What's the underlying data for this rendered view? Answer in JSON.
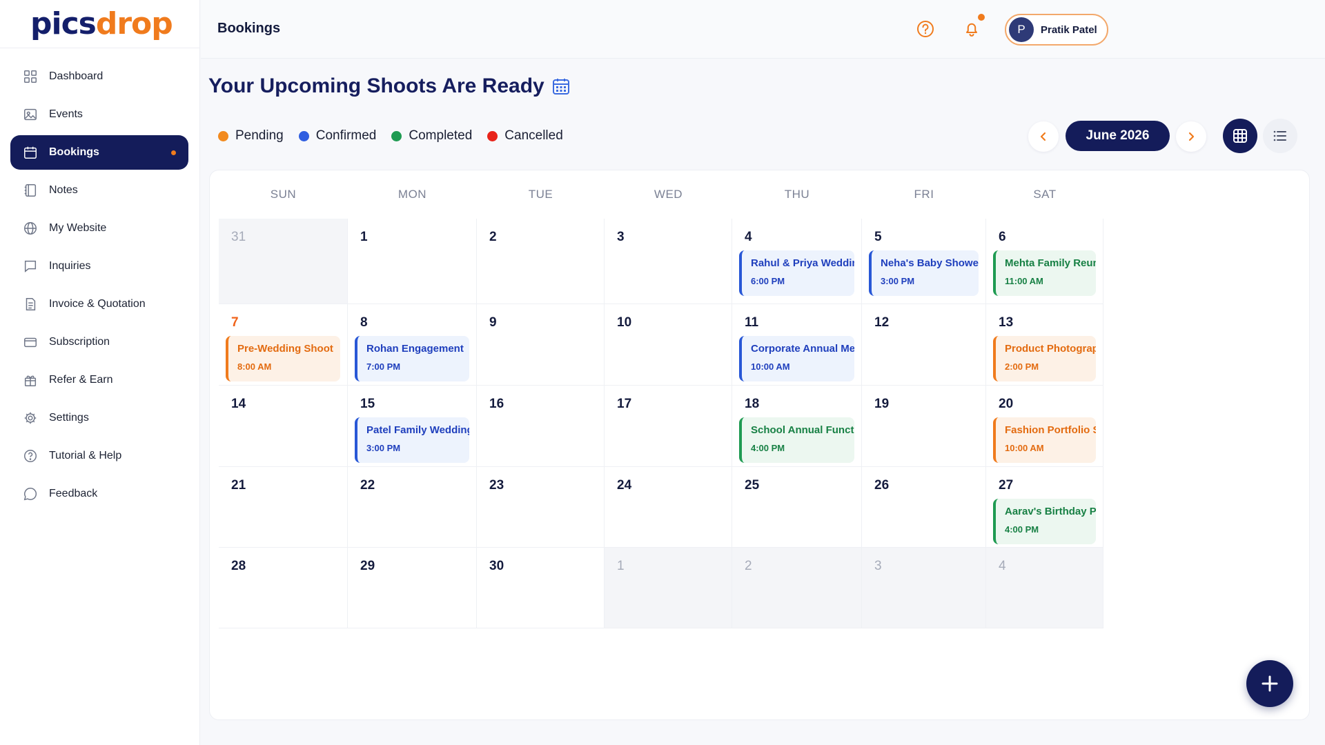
{
  "app": {
    "logo_part1": "pics",
    "logo_part2": "drop"
  },
  "sidebar": {
    "items": [
      {
        "label": "Dashboard",
        "icon": "dashboard-icon"
      },
      {
        "label": "Events",
        "icon": "image-icon"
      },
      {
        "label": "Bookings",
        "icon": "calendar-icon",
        "active": true
      },
      {
        "label": "Notes",
        "icon": "notebook-icon"
      },
      {
        "label": "My Website",
        "icon": "globe-icon"
      },
      {
        "label": "Inquiries",
        "icon": "chat-icon"
      },
      {
        "label": "Invoice & Quotation",
        "icon": "document-icon"
      },
      {
        "label": "Subscription",
        "icon": "card-icon"
      },
      {
        "label": "Refer & Earn",
        "icon": "gift-icon"
      },
      {
        "label": "Settings",
        "icon": "gear-icon"
      },
      {
        "label": "Tutorial & Help",
        "icon": "help-circle-icon"
      },
      {
        "label": "Feedback",
        "icon": "message-icon"
      }
    ]
  },
  "header": {
    "page_label": "Bookings",
    "user_initial": "P",
    "user_name": "Pratik Patel"
  },
  "main": {
    "heading": "Your Upcoming Shoots Are Ready",
    "legend": [
      {
        "label": "Pending",
        "color": "#f28a1e"
      },
      {
        "label": "Confirmed",
        "color": "#2f5ee0"
      },
      {
        "label": "Completed",
        "color": "#1f9b52"
      },
      {
        "label": "Cancelled",
        "color": "#e8231a"
      }
    ],
    "month_label": "June  2026",
    "weekdays": [
      "SUN",
      "MON",
      "TUE",
      "WED",
      "THU",
      "FRI",
      "SAT"
    ],
    "days": [
      {
        "day": "31",
        "muted": true
      },
      {
        "day": "1"
      },
      {
        "day": "2"
      },
      {
        "day": "3"
      },
      {
        "day": "4",
        "event": {
          "title": "Rahul & Priya Wedding",
          "time": "6:00 PM",
          "status": "blue"
        }
      },
      {
        "day": "5",
        "event": {
          "title": "Neha's Baby Shower",
          "time": "3:00 PM",
          "status": "blue"
        }
      },
      {
        "day": "6",
        "event": {
          "title": "Mehta Family Reunion",
          "time": "11:00 AM",
          "status": "green"
        }
      },
      {
        "day": "7",
        "red": true,
        "event": {
          "title": "Pre-Wedding Shoot",
          "time": "8:00 AM",
          "status": "orange"
        }
      },
      {
        "day": "8",
        "event": {
          "title": "Rohan Engagement",
          "time": "7:00 PM",
          "status": "blue"
        }
      },
      {
        "day": "9"
      },
      {
        "day": "10"
      },
      {
        "day": "11",
        "event": {
          "title": "Corporate Annual Meet",
          "time": "10:00 AM",
          "status": "blue"
        }
      },
      {
        "day": "12"
      },
      {
        "day": "13",
        "event": {
          "title": "Product Photography",
          "time": "2:00 PM",
          "status": "orange"
        }
      },
      {
        "day": "14"
      },
      {
        "day": "15",
        "event": {
          "title": "Patel Family Wedding",
          "time": "3:00 PM",
          "status": "blue"
        }
      },
      {
        "day": "16"
      },
      {
        "day": "17"
      },
      {
        "day": "18",
        "event": {
          "title": "School Annual Function",
          "time": "4:00 PM",
          "status": "green"
        }
      },
      {
        "day": "19"
      },
      {
        "day": "20",
        "event": {
          "title": "Fashion Portfolio Shoot",
          "time": "10:00 AM",
          "status": "orange"
        }
      },
      {
        "day": "21"
      },
      {
        "day": "22"
      },
      {
        "day": "23"
      },
      {
        "day": "24"
      },
      {
        "day": "25"
      },
      {
        "day": "26"
      },
      {
        "day": "27",
        "event": {
          "title": "Aarav's Birthday Party",
          "time": "4:00 PM",
          "status": "green"
        }
      },
      {
        "day": "28"
      },
      {
        "day": "29"
      },
      {
        "day": "30"
      },
      {
        "day": "1",
        "muted": true
      },
      {
        "day": "2",
        "muted": true
      },
      {
        "day": "3",
        "muted": true
      },
      {
        "day": "4",
        "muted": true
      }
    ]
  }
}
